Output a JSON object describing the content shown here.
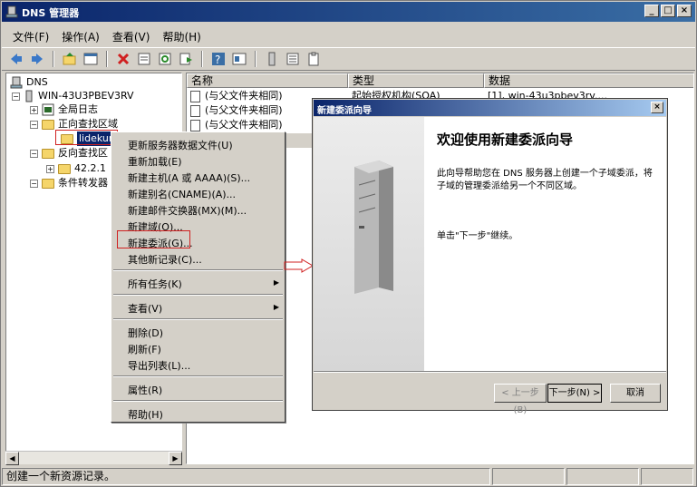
{
  "window": {
    "title": "DNS 管理器",
    "controls": {
      "min": "_",
      "max": "□",
      "close": "×"
    }
  },
  "menubar": [
    "文件(F)",
    "操作(A)",
    "查看(V)",
    "帮助(H)"
  ],
  "toolbar_icons": [
    "back-icon",
    "forward-icon",
    "up-icon",
    "view-icon",
    "delete-icon",
    "properties-icon",
    "refresh-icon",
    "export-icon",
    "help-icon",
    "console-icon",
    "server-icon",
    "list-icon",
    "clipboard-icon"
  ],
  "tree": {
    "root": "DNS",
    "server": "WIN-43U3PBEV3RV",
    "global_log": "全局日志",
    "forward_zone": "正向查找区域",
    "selected_zone": "lidekun",
    "reverse_zone": "反向查找区",
    "reverse_child": "42.2.1",
    "conditional": "条件转发器"
  },
  "list": {
    "headers": [
      "名称",
      "类型",
      "数据"
    ],
    "rows": [
      {
        "name": "(与父文件夹相同)",
        "type": "起始授权机构(SOA)",
        "data": "[1], win-43u3pbev3rv...."
      },
      {
        "name": "(与父文件夹相同)",
        "type": "",
        "data": ""
      },
      {
        "name": "(与父文件夹相同)",
        "type": "",
        "data": ""
      }
    ]
  },
  "context_menu": {
    "items": [
      "更新服务器数据文件(U)",
      "重新加载(E)",
      "新建主机(A 或 AAAA)(S)...",
      "新建别名(CNAME)(A)...",
      "新建邮件交换器(MX)(M)...",
      "新建域(O)...",
      "新建委派(G)...",
      "其他新记录(C)...",
      "所有任务(K)",
      "查看(V)",
      "删除(D)",
      "刷新(F)",
      "导出列表(L)...",
      "属性(R)",
      "帮助(H)"
    ]
  },
  "wizard": {
    "title": "新建委派向导",
    "close": "×",
    "heading": "欢迎使用新建委派向导",
    "para1": "此向导帮助您在 DNS 服务器上创建一个子域委派，将子域的管理委派给另一个不同区域。",
    "para2": "单击\"下一步\"继续。",
    "buttons": {
      "back": "< 上一步(B)",
      "next": "下一步(N) >",
      "cancel": "取消"
    }
  },
  "statusbar": {
    "text": "创建一个新资源记录。"
  },
  "colors": {
    "title_start": "#0a246a",
    "title_end": "#3a6ea5",
    "highlight_red": "#d02020",
    "selection": "#0a246a"
  }
}
